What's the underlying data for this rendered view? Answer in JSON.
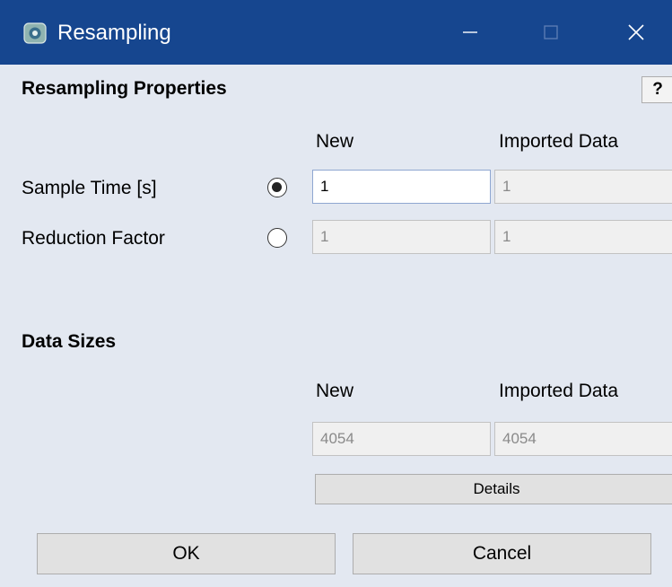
{
  "window": {
    "title": "Resampling",
    "controls": {
      "minimize": "minimize-icon",
      "maximize": "maximize-icon",
      "close": "close-icon"
    },
    "colors": {
      "titlebar": "#16468f",
      "background": "#e3e8f1"
    }
  },
  "resampling_properties": {
    "title": "Resampling Properties",
    "help_label": "?",
    "col_new": "New",
    "col_imported": "Imported Data",
    "sample_time": {
      "label": "Sample Time [s]",
      "selected": true,
      "new_value": "1",
      "imported_value": "1"
    },
    "reduction_factor": {
      "label": "Reduction Factor",
      "selected": false,
      "new_value": "1",
      "imported_value": "1"
    }
  },
  "data_sizes": {
    "title": "Data Sizes",
    "col_new": "New",
    "col_imported": "Imported Data",
    "new_value": "4054",
    "imported_value": "4054",
    "details_label": "Details"
  },
  "footer": {
    "ok_label": "OK",
    "cancel_label": "Cancel"
  }
}
